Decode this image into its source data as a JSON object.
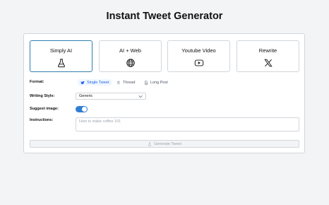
{
  "page_title": "Instant Tweet Generator",
  "modes": [
    {
      "label": "Simply AI",
      "icon": "flask-icon",
      "active": true
    },
    {
      "label": "AI + Web",
      "icon": "globe-icon",
      "active": false
    },
    {
      "label": "Youtube Video",
      "icon": "youtube-icon",
      "active": false
    },
    {
      "label": "Rewrite",
      "icon": "x-logo-icon",
      "active": false
    }
  ],
  "format": {
    "label": "Format:",
    "options": [
      "Single Tweet",
      "Thread",
      "Long Post"
    ],
    "selected": "Single Tweet"
  },
  "writing_style": {
    "label": "Writing Style:",
    "value": "Generic"
  },
  "suggest_image": {
    "label": "Suggest image:",
    "enabled": true
  },
  "instructions": {
    "label": "Instructions:",
    "placeholder": "How to make coffee 101"
  },
  "generate_button": {
    "label": "Generate Tweet"
  },
  "colors": {
    "accent": "#2f7fd1",
    "active_border": "#2f7fb0",
    "selected_text": "#2563eb"
  }
}
